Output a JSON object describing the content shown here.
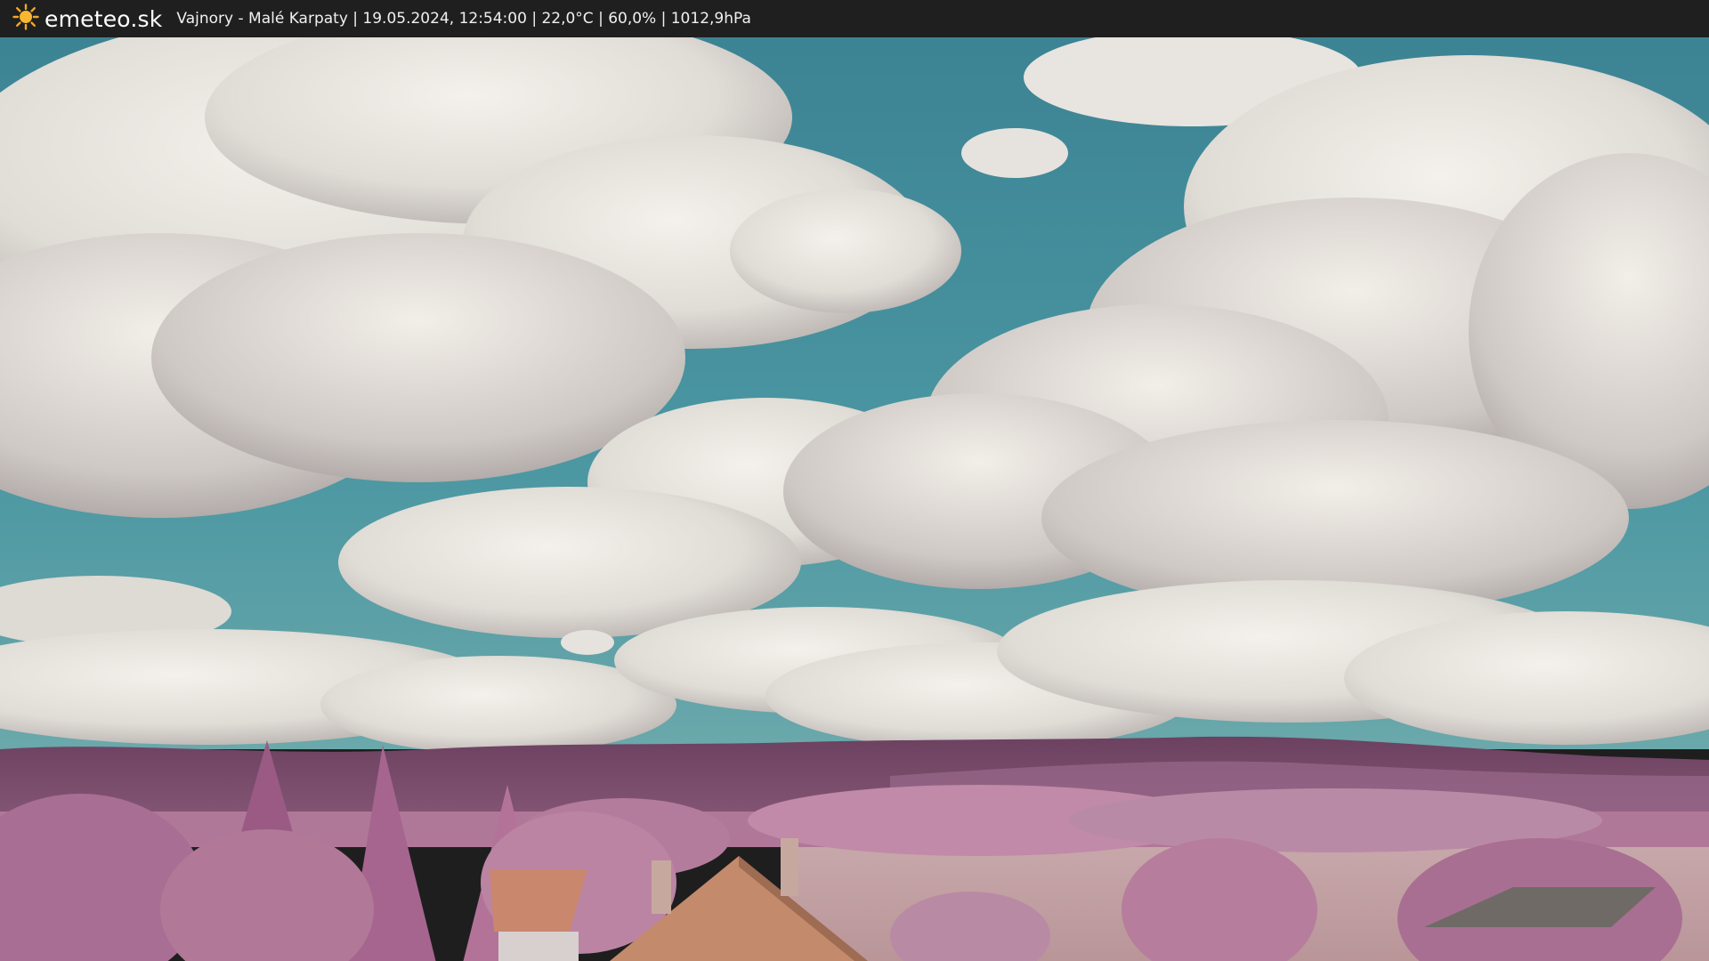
{
  "header": {
    "logo_text": "emeteo.sk",
    "logo_icon": "sun-icon",
    "caption": "Vajnory - Malé Karpaty | 19.05.2024, 12:54:00 | 22,0°C | 60,0% | 1012,9hPa"
  },
  "scene": {
    "description_icon": "webcam-image",
    "colors": {
      "sky": "#3f8a98",
      "cloud_light": "#ece9e3",
      "cloud_shade": "#b7b1ae",
      "hills": "#7a4b6b",
      "foliage": "#b57a9c",
      "field": "#c4a3a6",
      "roof": "#c9876e"
    }
  }
}
